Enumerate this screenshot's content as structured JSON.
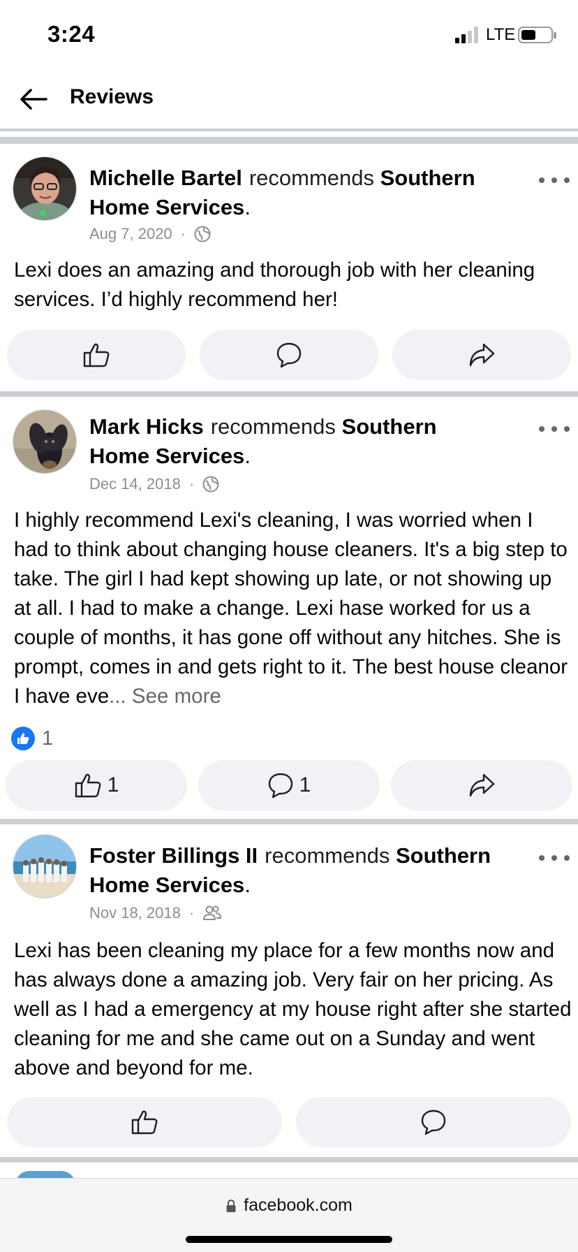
{
  "status_bar": {
    "time": "3:24",
    "network": "LTE"
  },
  "header": {
    "title": "Reviews",
    "back_icon": "arrow-left-icon"
  },
  "reviews": [
    {
      "author": "Michelle Bartel",
      "recommends_text": "recommends",
      "page_name": "Southern Home Services",
      "period": ".",
      "date": "Aug 7, 2020",
      "separator": "·",
      "audience_icon": "globe-icon",
      "text": "Lexi does an amazing and thorough job with her cleaning services. I’d highly recommend her!",
      "see_more": "",
      "reaction_count": "",
      "like_count": "",
      "comment_count": ""
    },
    {
      "author": "Mark Hicks",
      "recommends_text": "recommends",
      "page_name": "Southern Home Services",
      "period": ".",
      "date": "Dec 14, 2018",
      "separator": "·",
      "audience_icon": "globe-icon",
      "text": "I highly recommend Lexi's cleaning, I was worried when I had to think about changing house cleaners. It's a big step to take. The girl I had kept showing up late, or not showing up at all. I had to make a change. Lexi hase worked for us a couple of months, it has gone off without any hitches. She is prompt, comes in and gets right to it. The best house cleanor I have eve",
      "see_more": "... See more",
      "reaction_count": "1",
      "like_count": "1",
      "comment_count": "1"
    },
    {
      "author": "Foster Billings II",
      "recommends_text": "recommends",
      "page_name": "Southern Home Services",
      "period": ".",
      "date": "Nov 18, 2018",
      "separator": "·",
      "audience_icon": "friends-icon",
      "text": "Lexi has been cleaning my place for a few months now and has always done a amazing job.  Very fair on her pricing.  As well as I had a emergency at my house right after she started cleaning for me and she came out on a Sunday and went above and beyond for me.",
      "see_more": "",
      "reaction_count": "",
      "like_count": "",
      "comment_count": ""
    }
  ],
  "browser": {
    "url": "facebook.com"
  },
  "colors": {
    "accent": "#1877f2",
    "button_bg": "#f0f2f5",
    "divider": "#ccced4",
    "meta_text": "#8a8d91"
  }
}
